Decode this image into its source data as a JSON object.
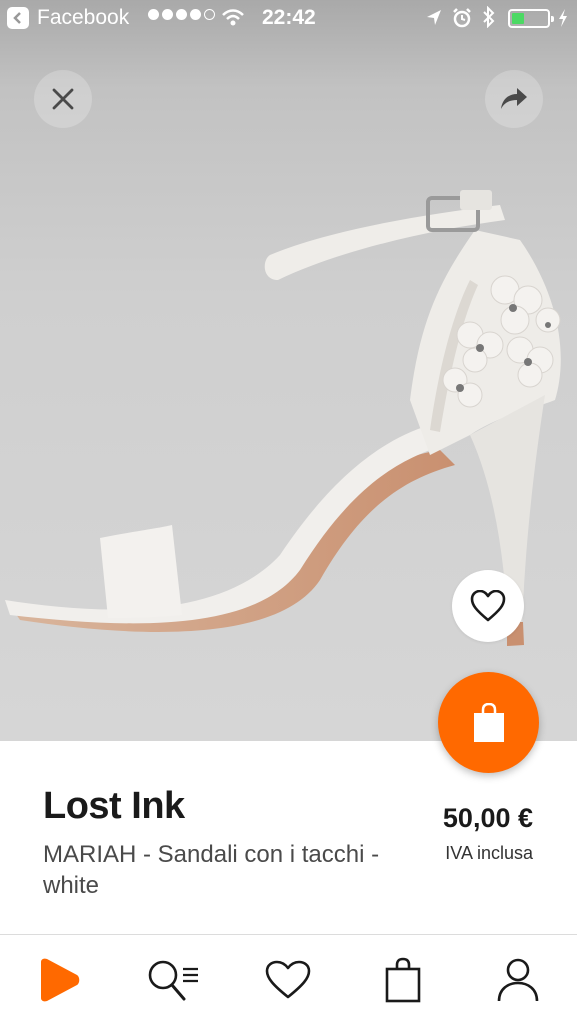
{
  "status_bar": {
    "back_app": "Facebook",
    "time": "22:42",
    "signal_filled": 4,
    "signal_total": 5,
    "battery_level": 0.3,
    "battery_color": "#4cd964",
    "icons": [
      "back-icon",
      "wifi-icon",
      "location-icon",
      "alarm-icon",
      "bluetooth-icon",
      "battery-icon",
      "charging-icon"
    ]
  },
  "top_actions": {
    "close_icon": "close-icon",
    "share_icon": "share-icon"
  },
  "image_actions": {
    "wishlist_icon": "heart-icon",
    "cart_icon": "shopping-bag-icon"
  },
  "product": {
    "brand": "Lost Ink",
    "title": "MARIAH - Sandali con i tacchi - white",
    "price": "50,00 €",
    "vat_note": "IVA inclusa"
  },
  "tab_bar": {
    "items": [
      {
        "icon": "home-logo-icon",
        "active": true
      },
      {
        "icon": "search-icon",
        "active": false
      },
      {
        "icon": "wishlist-icon",
        "active": false
      },
      {
        "icon": "bag-icon",
        "active": false
      },
      {
        "icon": "profile-icon",
        "active": false
      }
    ]
  },
  "colors": {
    "accent": "#ff6900",
    "text": "#1a1a1a",
    "secondary_text": "#4a4a4a"
  }
}
